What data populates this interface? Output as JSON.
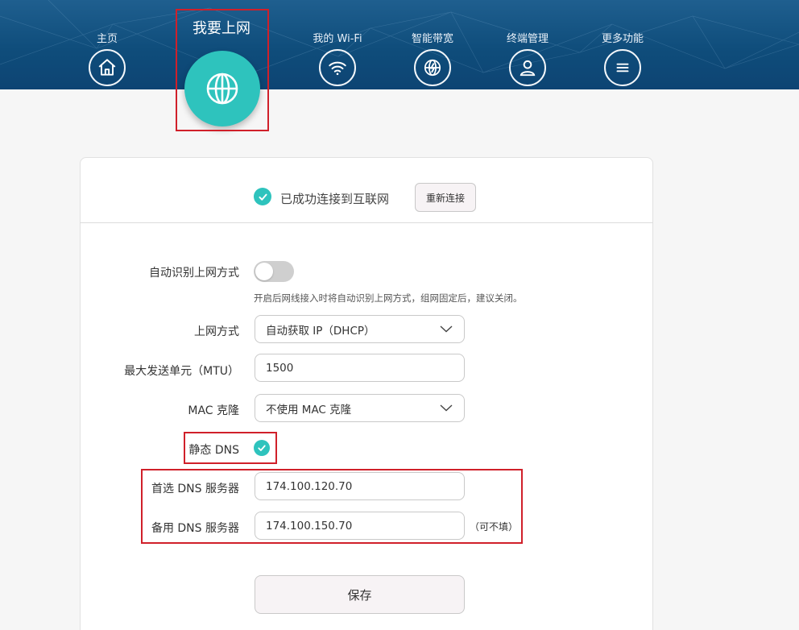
{
  "nav": {
    "items": [
      {
        "label": "主页",
        "icon": "home-icon"
      },
      {
        "label": "我要上网",
        "icon": "globe-icon",
        "active": true
      },
      {
        "label": "我的 Wi-Fi",
        "icon": "wifi-icon"
      },
      {
        "label": "智能带宽",
        "icon": "bandwidth-globe-icon"
      },
      {
        "label": "终端管理",
        "icon": "user-icon"
      },
      {
        "label": "更多功能",
        "icon": "menu-icon"
      }
    ]
  },
  "status": {
    "text": "已成功连接到互联网",
    "reconnect_label": "重新连接"
  },
  "form": {
    "auto_detect_label": "自动识别上网方式",
    "auto_detect_on": false,
    "auto_detect_hint": "开启后网线接入时将自动识别上网方式，组网固定后，建议关闭。",
    "connection_type_label": "上网方式",
    "connection_type_value": "自动获取 IP（DHCP）",
    "mtu_label": "最大发送单元（MTU）",
    "mtu_value": "1500",
    "mac_clone_label": "MAC 克隆",
    "mac_clone_value": "不使用 MAC 克隆",
    "static_dns_label": "静态 DNS",
    "static_dns_checked": true,
    "primary_dns_label": "首选 DNS 服务器",
    "primary_dns_value": "174.100.120.70",
    "secondary_dns_label": "备用 DNS 服务器",
    "secondary_dns_value": "174.100.150.70",
    "optional_note": "（可不填）",
    "save_label": "保存"
  },
  "colors": {
    "accent": "#2ec3bd",
    "header": "#0f4d7b",
    "highlight_box": "#d0202a"
  }
}
